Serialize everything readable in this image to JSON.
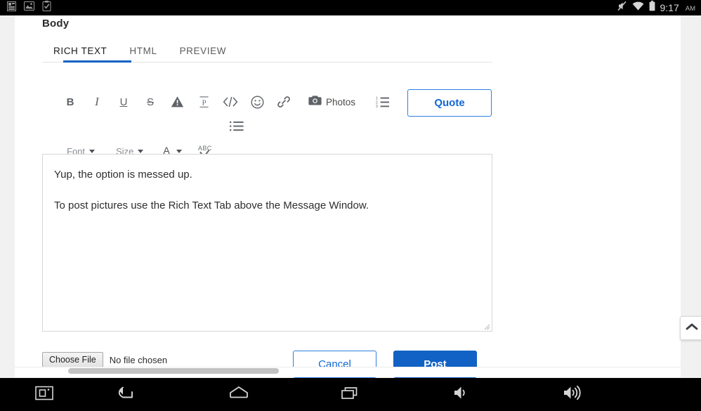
{
  "status_bar": {
    "icons": [
      "sd-card-icon",
      "screenshot-image-icon",
      "clipboard-check-icon"
    ],
    "right_icons": [
      "mute-icon",
      "wifi-icon",
      "battery-icon"
    ],
    "clock": "9:17",
    "meridiem": "AM"
  },
  "page": {
    "section_label": "Body",
    "tabs": [
      {
        "label": "RICH TEXT",
        "active": true
      },
      {
        "label": "HTML",
        "active": false
      },
      {
        "label": "PREVIEW",
        "active": false
      }
    ],
    "toolbar_row1": [
      {
        "name": "bold-button",
        "glyph": "B",
        "kind": "bold"
      },
      {
        "name": "italic-button",
        "glyph": "I",
        "kind": "ital"
      },
      {
        "name": "underline-button",
        "glyph": "U",
        "kind": "under"
      },
      {
        "name": "strikethrough-button",
        "glyph": "S",
        "kind": "strike"
      },
      {
        "name": "warning-triangle-button",
        "glyph": "",
        "kind": "svg-warning"
      },
      {
        "name": "remove-formatting-button",
        "glyph": "",
        "kind": "svg-pformat"
      },
      {
        "name": "source-code-button",
        "glyph": "",
        "kind": "svg-code"
      },
      {
        "name": "emoji-button",
        "glyph": "",
        "kind": "svg-emoji"
      },
      {
        "name": "insert-link-button",
        "glyph": "",
        "kind": "svg-link"
      }
    ],
    "photos_button": {
      "label": "Photos",
      "icon": "camera-icon"
    },
    "ordered_list_button": "ordered-list-icon",
    "unordered_list_button": "unordered-list-icon",
    "quote_button": "Quote",
    "font_dropdown": "Font",
    "size_dropdown": "Size",
    "text_color_button": "A",
    "spellcheck_button": "ABC",
    "editor_text": "Yup, the option is messed up.\n\nTo post pictures use the Rich Text Tab above the Message Window.",
    "choose_file_button": "Choose File",
    "file_status": "No file chosen",
    "cancel_button": "Cancel",
    "post_button": "Post",
    "scroll_top_button": "chevron-up-icon"
  },
  "nav_bar": {
    "buttons": [
      {
        "name": "screenshot-button",
        "icon": "screenshot-icon"
      },
      {
        "name": "back-button",
        "icon": "back-arrow-icon"
      },
      {
        "name": "home-button",
        "icon": "home-icon"
      },
      {
        "name": "recents-button",
        "icon": "recents-icon"
      },
      {
        "name": "volume-down-button",
        "icon": "volume-low-icon"
      },
      {
        "name": "volume-up-button",
        "icon": "volume-high-icon"
      }
    ]
  },
  "colors": {
    "accent_blue": "#1162c4",
    "link_blue": "#1168d6",
    "page_bg": "#ffffff",
    "gutter_bg": "#f1f1f1",
    "system_bar": "#000000"
  }
}
